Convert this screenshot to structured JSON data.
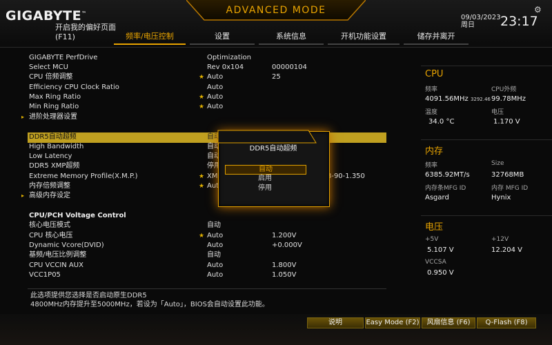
{
  "header": {
    "brand": "GIGABYTE",
    "favorites_label": "开启我的偏好页面",
    "favorites_key": "(F11)",
    "mode_title": "ADVANCED MODE",
    "date": "09/03/2023",
    "weekday": "周日",
    "time": "23:17",
    "tabs": [
      {
        "label": "频率/电压控制",
        "active": true
      },
      {
        "label": "设置",
        "active": false
      },
      {
        "label": "系统信息",
        "active": false
      },
      {
        "label": "开机功能设置",
        "active": false
      },
      {
        "label": "储存并离开",
        "active": false
      }
    ]
  },
  "settings": {
    "perfdrive": {
      "label": "GIGABYTE PerfDrive",
      "value": "Optimization"
    },
    "mcu": {
      "label": "Select MCU",
      "value": "Rev 0x104",
      "value2": "00000104"
    },
    "cpu_ratio": {
      "label": "CPU 倍频调整",
      "value": "Auto",
      "value2": "25"
    },
    "eff_ratio": {
      "label": "Efficiency CPU Clock Ratio",
      "value": "Auto"
    },
    "max_ring": {
      "label": "Max Ring Ratio",
      "value": "Auto"
    },
    "min_ring": {
      "label": "Min Ring Ratio",
      "value": "Auto"
    },
    "adv_cpu": {
      "label": "进阶处理器设置"
    },
    "ddr5_boost": {
      "label": "DDR5自动超频",
      "value": "自动"
    },
    "high_bw": {
      "label": "High Bandwidth",
      "value": "自动"
    },
    "low_lat": {
      "label": "Low Latency",
      "value": "自动"
    },
    "ddr5_xmp": {
      "label": "DDR5 XMP超频",
      "value": "停用"
    },
    "xmp": {
      "label": "Extreme Memory Profile(X.M.P.)",
      "value": "XMP",
      "value2": "-38-90-1.350"
    },
    "mem_ratio": {
      "label": "内存倍频调整",
      "value": "Auto"
    },
    "adv_mem": {
      "label": "高级内存设定"
    },
    "voltage_head": {
      "label": "CPU/PCH Voltage Control"
    },
    "core_mode": {
      "label": "核心电压模式",
      "value": "自动"
    },
    "cpu_vcore": {
      "label": "CPU 核心电压",
      "value": "Auto",
      "value2": "1.200V"
    },
    "dyn_vcore": {
      "label": "Dynamic Vcore(DVID)",
      "value": "Auto",
      "value2": "+0.000V"
    },
    "base_ratio": {
      "label": "基频/电压比例调整",
      "value": "自动"
    },
    "vccin_aux": {
      "label": "CPU VCCIN AUX",
      "value": "Auto",
      "value2": "1.800V"
    },
    "vcc1p05": {
      "label": "VCC1P05",
      "value": "Auto",
      "value2": "1.050V"
    }
  },
  "popup": {
    "title": "DDR5自动超频",
    "options": [
      "自动",
      "启用",
      "停用"
    ],
    "selected_index": 0
  },
  "panel": {
    "cpu": {
      "title": "CPU",
      "freq_label": "频率",
      "freq_value": "4091.56MHz",
      "freq_sub": "3292.46",
      "ext_label": "CPU外频",
      "ext_value": "99.78MHz",
      "temp_label": "温度",
      "temp_value": "34.0 °C",
      "volt_label": "电压",
      "volt_value": "1.170 V"
    },
    "memory": {
      "title": "内存",
      "freq_label": "频率",
      "freq_value": "6385.92MT/s",
      "size_label": "Size",
      "size_value": "32768MB",
      "mfg1_label": "内存条MFG ID",
      "mfg1_value": "Asgard",
      "mfg2_label": "内存 MFG ID",
      "mfg2_value": "Hynix"
    },
    "voltage": {
      "title": "电压",
      "p5_label": "+5V",
      "p5_value": "5.107 V",
      "p12_label": "+12V",
      "p12_value": "12.204 V",
      "vccsa_label": "VCCSA",
      "vccsa_value": "0.950 V"
    }
  },
  "help": {
    "line1": "此选项提供您选择是否启动原生DDR5",
    "line2": "4800MHz内存提升至5000MHz，若设为「Auto」，BIOS会自动设置此功能。"
  },
  "footer": {
    "explain": "说明",
    "easy_mode": "Easy Mode (F2)",
    "fan_info": "风扇信息 (F6)",
    "qflash": "Q-Flash (F8)"
  },
  "colors": {
    "accent": "#e9a400",
    "selected_row": "#c0a020",
    "background": "#0a0a0a"
  }
}
